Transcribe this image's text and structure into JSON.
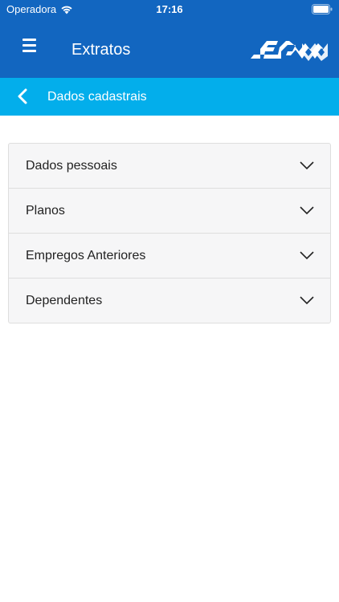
{
  "status_bar": {
    "carrier": "Operadora",
    "time": "17:16"
  },
  "header": {
    "title": "Extratos",
    "menu_icon": "hamburger-menu-icon",
    "logo": "fbss-logo"
  },
  "sub_header": {
    "title": "Dados cadastrais",
    "back_icon": "chevron-left-icon"
  },
  "accordion": [
    {
      "label": "Dados pessoais"
    },
    {
      "label": "Planos"
    },
    {
      "label": "Empregos Anteriores"
    },
    {
      "label": "Dependentes"
    }
  ],
  "colors": {
    "primary": "#1266c0",
    "secondary": "#03aeeb",
    "panel": "#f6f6f7"
  }
}
